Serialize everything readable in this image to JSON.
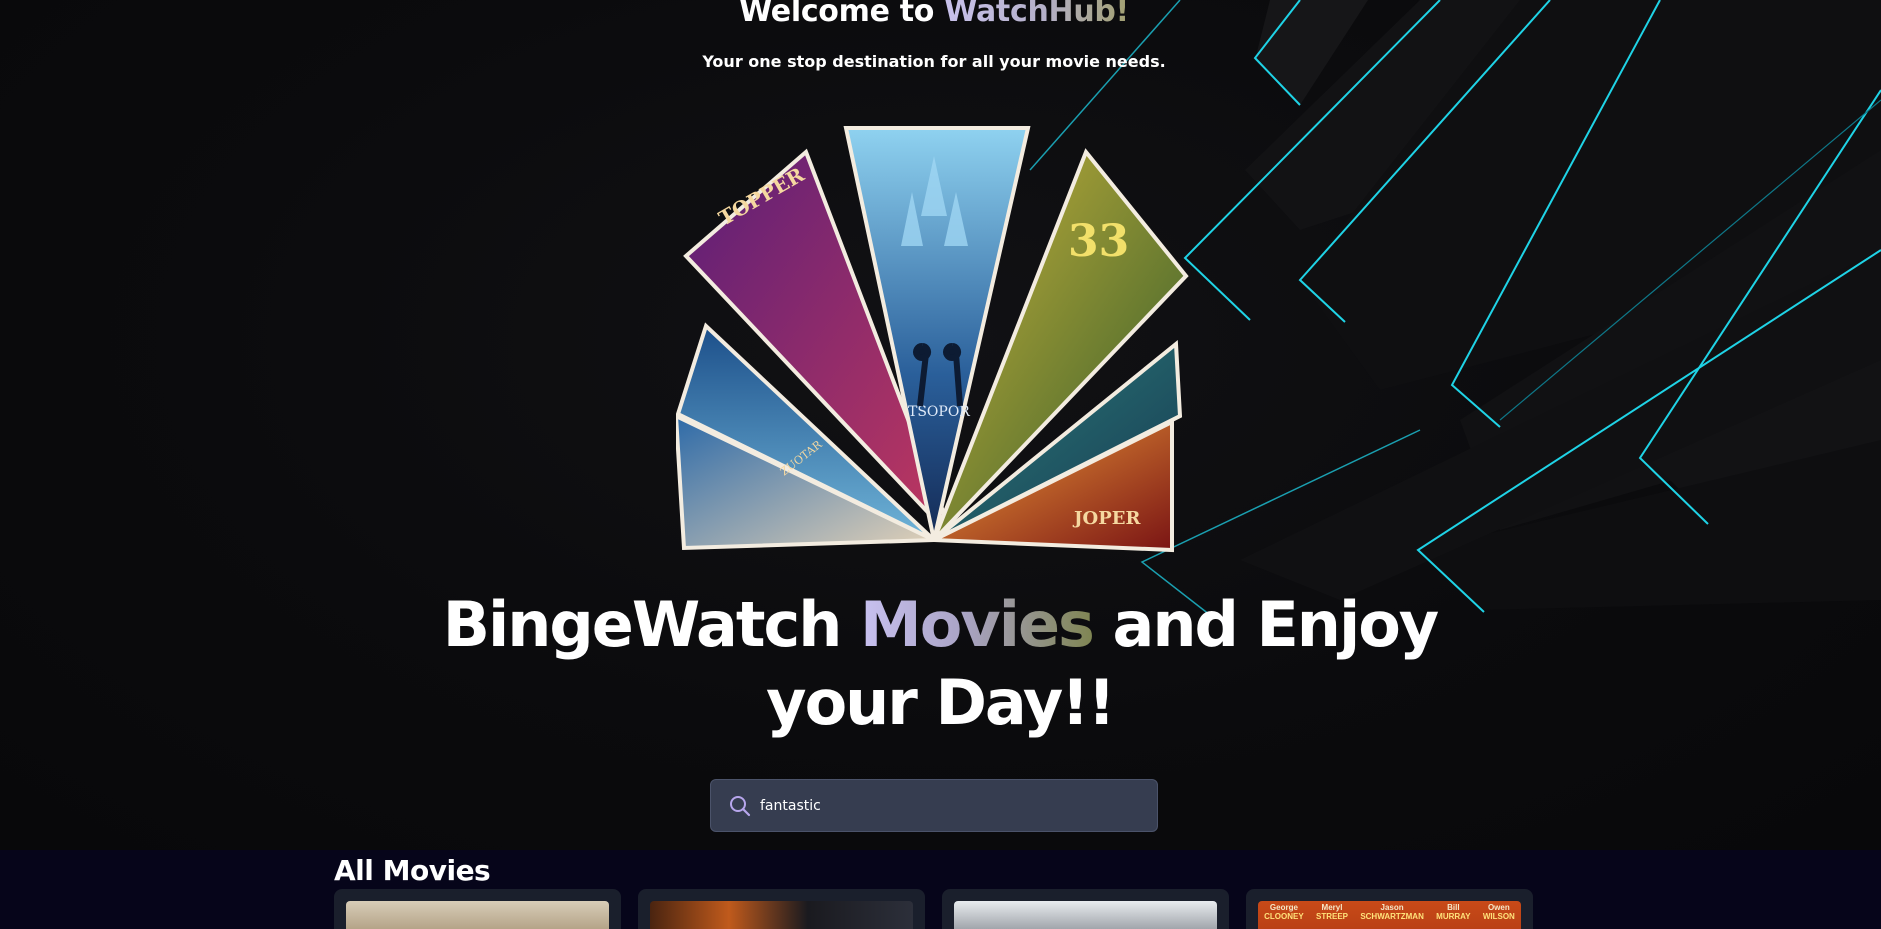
{
  "hero": {
    "welcome_prefix": "Welcome to ",
    "welcome_brand": "WatchHub!",
    "tagline": "Your one stop destination for all your movie needs.",
    "headline_part1": "BingeWatch ",
    "headline_accent": "Movies",
    "headline_part2": " and Enjoy your Day!!"
  },
  "poster_fan": {
    "labels": [
      "TOPPER",
      "ZUOTAR",
      "TSOPOR",
      "33",
      "JOPER"
    ]
  },
  "search": {
    "value": "fantastic",
    "icon": "search-icon"
  },
  "movies": {
    "section_title": "All Movies",
    "card4_cast": [
      {
        "first": "George",
        "last": "CLOONEY"
      },
      {
        "first": "Meryl",
        "last": "STREEP"
      },
      {
        "first": "Jason",
        "last": "SCHWARTZMAN"
      },
      {
        "first": "Bill",
        "last": "MURRAY"
      },
      {
        "first": "Owen",
        "last": "WILSON"
      }
    ]
  },
  "colors": {
    "background": "#0a0a0c",
    "neon_cyan": "#1fd3e6",
    "search_bg": "#363d50",
    "movies_bg": "#06051a",
    "accent_lavender": "#c9c2ec",
    "accent_olive": "#8a8c50"
  }
}
